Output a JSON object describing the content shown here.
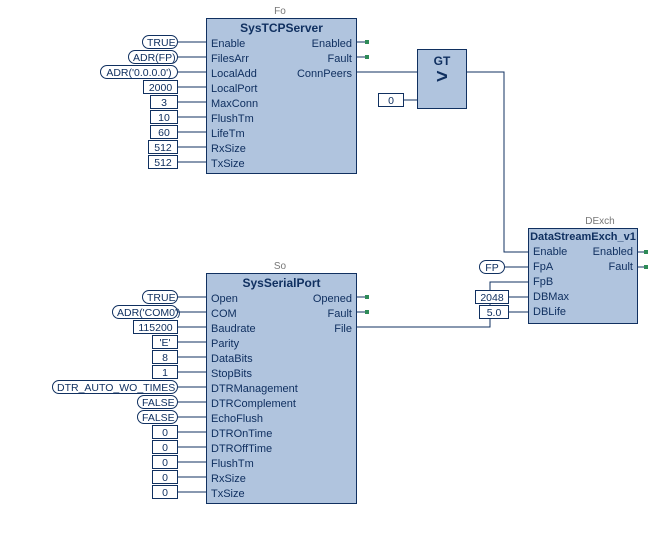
{
  "blocks": {
    "tcp": {
      "instance": "Fo",
      "title": "SysTCPServer",
      "inputs": [
        "Enable",
        "FilesArr",
        "LocalAdd",
        "LocalPort",
        "MaxConn",
        "FlushTm",
        "LifeTm",
        "RxSize",
        "TxSize"
      ],
      "outputs": [
        "Enabled",
        "Fault",
        "ConnPeers"
      ],
      "params": [
        {
          "label": "TRUE",
          "rounded": true
        },
        {
          "label": "ADR(FP)",
          "rounded": true
        },
        {
          "label": "ADR('0.0.0.0')",
          "rounded": true
        },
        {
          "label": "2000",
          "rounded": false
        },
        {
          "label": "3",
          "rounded": false
        },
        {
          "label": "10",
          "rounded": false
        },
        {
          "label": "60",
          "rounded": false
        },
        {
          "label": "512",
          "rounded": false
        },
        {
          "label": "512",
          "rounded": false
        }
      ]
    },
    "serial": {
      "instance": "So",
      "title": "SysSerialPort",
      "inputs": [
        "Open",
        "COM",
        "Baudrate",
        "Parity",
        "DataBits",
        "StopBits",
        "DTRManagement",
        "DTRComplement",
        "EchoFlush",
        "DTROnTime",
        "DTROffTime",
        "FlushTm",
        "RxSize",
        "TxSize"
      ],
      "outputs": [
        "Opened",
        "Fault",
        "File"
      ],
      "params": [
        {
          "label": "TRUE",
          "rounded": true
        },
        {
          "label": "ADR('COM0')",
          "rounded": true
        },
        {
          "label": "115200",
          "rounded": false
        },
        {
          "label": "'E'",
          "rounded": false
        },
        {
          "label": "8",
          "rounded": false
        },
        {
          "label": "1",
          "rounded": false
        },
        {
          "label": "DTR_AUTO_WO_TIMES",
          "rounded": true
        },
        {
          "label": "FALSE",
          "rounded": true
        },
        {
          "label": "FALSE",
          "rounded": true
        },
        {
          "label": "0",
          "rounded": false
        },
        {
          "label": "0",
          "rounded": false
        },
        {
          "label": "0",
          "rounded": false
        },
        {
          "label": "0",
          "rounded": false
        },
        {
          "label": "0",
          "rounded": false
        }
      ]
    },
    "gt": {
      "title": "GT",
      "symbol": ">",
      "param": {
        "label": "0"
      }
    },
    "dse": {
      "instance": "DExch",
      "title": "DataStreamExch_v1",
      "inputs": [
        "Enable",
        "FpA",
        "FpB",
        "DBMax",
        "DBLife"
      ],
      "outputs": [
        "Enabled",
        "Fault"
      ],
      "params": {
        "FpA": "FP",
        "DBMax": "2048",
        "DBLife": "5.0"
      }
    }
  }
}
